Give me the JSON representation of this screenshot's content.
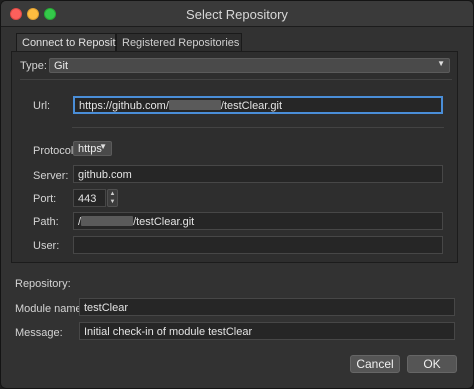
{
  "window": {
    "title": "Select Repository"
  },
  "tabs": [
    {
      "label": "Connect to Repository"
    },
    {
      "label": "Registered Repositories"
    }
  ],
  "type": {
    "label": "Type:",
    "value": "Git"
  },
  "url": {
    "label": "Url:",
    "prefix": "https://github.com/",
    "suffix": "/testClear.git"
  },
  "protocol": {
    "label": "Protocol:",
    "value": "https"
  },
  "server": {
    "label": "Server:",
    "value": "github.com"
  },
  "port": {
    "label": "Port:",
    "value": "443"
  },
  "path": {
    "label": "Path:",
    "prefix": "/",
    "suffix": "/testClear.git"
  },
  "user": {
    "label": "User:",
    "value": ""
  },
  "repository": {
    "label": "Repository:"
  },
  "module": {
    "label": "Module name:",
    "value": "testClear"
  },
  "message": {
    "label": "Message:",
    "value": "Initial check-in of module testClear"
  },
  "buttons": {
    "cancel": "Cancel",
    "ok": "OK"
  },
  "icons": {
    "dropdown": "chevron-down-icon",
    "spin_up": "up-arrow-icon",
    "spin_down": "down-arrow-icon"
  }
}
